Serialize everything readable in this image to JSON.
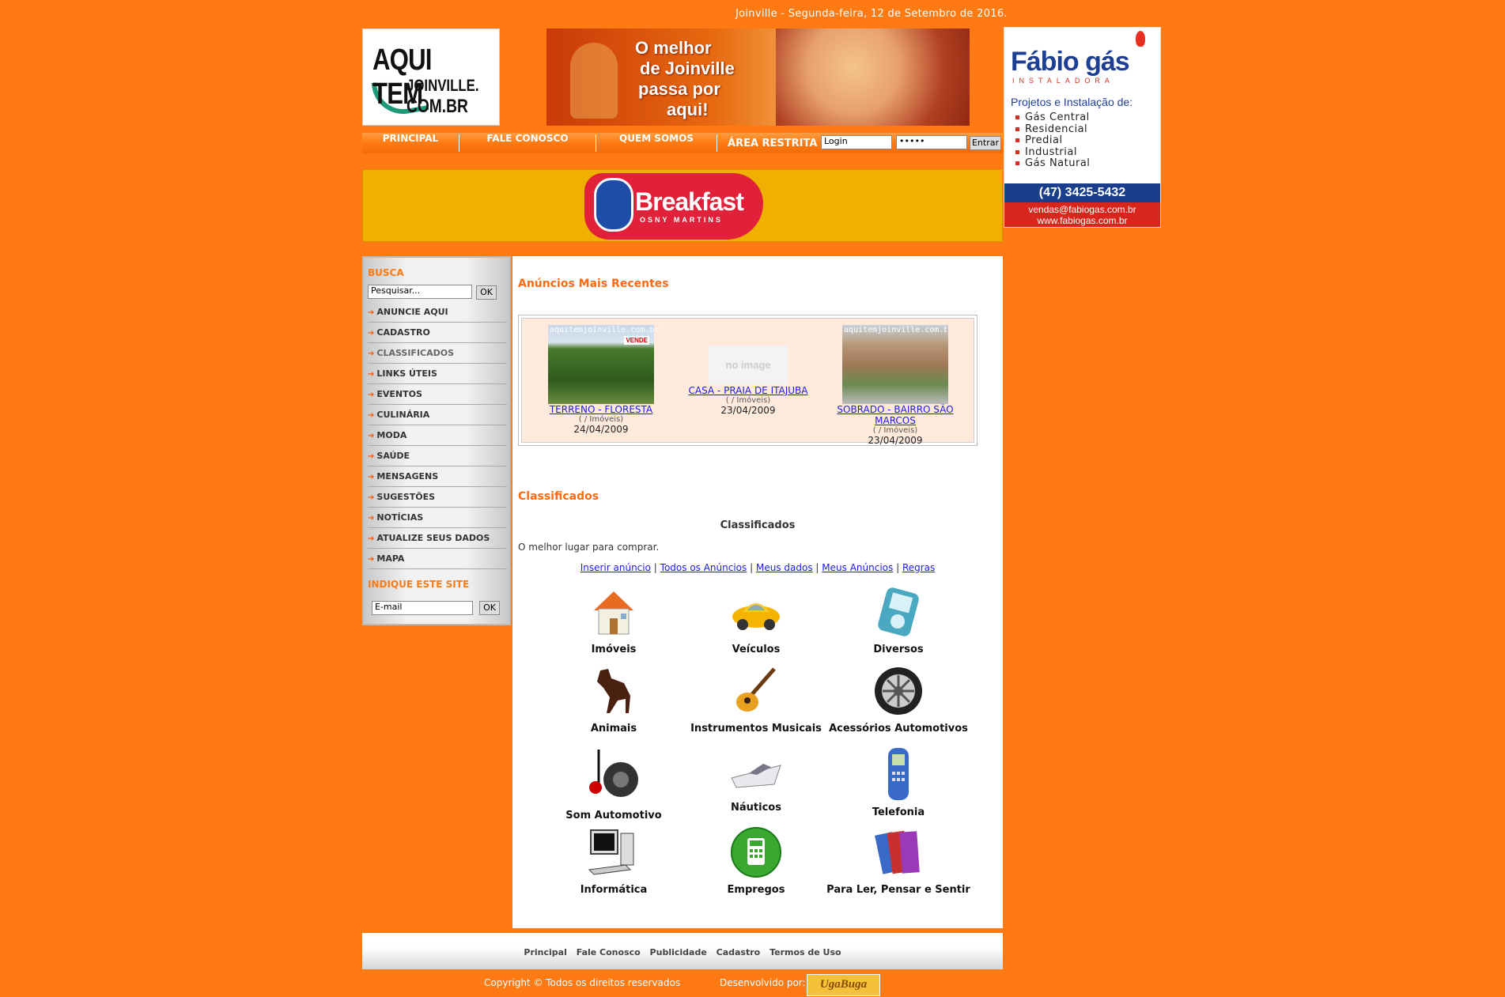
{
  "header": {
    "date_line": "Joinville - Segunda-feira, 12 de Setembro de 2016.",
    "logo": {
      "line1": "AQUI TEM",
      "line2": "JOINVILLE.",
      "line3": "COM.BR"
    },
    "banner": {
      "line1": "O melhor",
      "line2": "de Joinville",
      "line3": "passa por",
      "line4": "aqui!"
    }
  },
  "ad_fabio": {
    "brand": "Fábio gás",
    "subtitle": "INSTALADORA",
    "heading": "Projetos e Instalação de:",
    "items": [
      "Gás Central",
      "Residencial",
      "Predial",
      "Industrial",
      "Gás Natural"
    ],
    "phone": "(47) 3425-5432",
    "email": "vendas@fabiogas.com.br",
    "site": "www.fabiogas.com.br"
  },
  "nav": {
    "items": [
      "PRINCIPAL",
      "FALE CONOSCO",
      "QUEM SOMOS"
    ],
    "restricted_label": "ÁREA RESTRITA",
    "login_value": "Login",
    "password_value": "•••••",
    "submit_label": "Entrar"
  },
  "breakfast": {
    "title": "Breakfast",
    "subtitle": "OSNY MARTINS"
  },
  "sidebar": {
    "search_title": "BUSCA",
    "search_value": "Pesquisar...",
    "ok_label": "OK",
    "items": [
      "ANUNCIE AQUI",
      "CADASTRO",
      "CLASSIFICADOS",
      "LINKS ÚTEIS",
      "EVENTOS",
      "CULINÁRIA",
      "MODA",
      "SAÚDE",
      "MENSAGENS",
      "SUGESTÕES",
      "NOTÍCIAS",
      "ATUALIZE SEUS DADOS",
      "MAPA"
    ],
    "indique_title": "INDIQUE ESTE SITE",
    "email_value": "E-mail",
    "email_ok_label": "OK"
  },
  "main": {
    "recent_title": "Anúncios Mais Recentes",
    "recent": [
      {
        "title": "TERRENO - FLORESTA",
        "category": "( / Imóveis)",
        "date": "24/04/2009",
        "watermark": "aquitemjoinville.com.br",
        "sign": "VENDE"
      },
      {
        "title": "CASA - PRAIA DE ITAJUBA",
        "category": "( / Imóveis)",
        "date": "23/04/2009",
        "placeholder": "no image"
      },
      {
        "title": "SOBRADO - BAIRRO SÃO MARCOS",
        "category": "( / Imóveis)",
        "date": "23/04/2009",
        "watermark": "aquitemjoinville.com.br"
      }
    ],
    "classificados_title": "Classificados",
    "classificados_heading": "Classificados",
    "classificados_desc": "O melhor lugar para comprar.",
    "links": [
      "Inserir anúncio",
      "Todos os Anúncios",
      "Meus dados",
      "Meus Anúncios",
      "Regras"
    ],
    "link_separator": "|",
    "categories": [
      {
        "label": "Imóveis",
        "icon": "house-icon"
      },
      {
        "label": "Veículos",
        "icon": "car-icon"
      },
      {
        "label": "Diversos",
        "icon": "ipod-icon"
      },
      {
        "label": "Animais",
        "icon": "horse-icon"
      },
      {
        "label": "Instrumentos Musicais",
        "icon": "guitar-icon"
      },
      {
        "label": "Acessórios Automotivos",
        "icon": "wheel-icon"
      },
      {
        "label": "Som Automotivo",
        "icon": "speaker-icon"
      },
      {
        "label": "Náuticos",
        "icon": "boat-icon"
      },
      {
        "label": "Telefonia",
        "icon": "phone-icon"
      },
      {
        "label": "Informática",
        "icon": "computer-icon"
      },
      {
        "label": "Empregos",
        "icon": "calculator-icon"
      },
      {
        "label": "Para Ler, Pensar e Sentir",
        "icon": "books-icon"
      }
    ]
  },
  "footer": {
    "links": [
      "Principal",
      "Fale Conosco",
      "Publicidade",
      "Cadastro",
      "Termos de Uso"
    ],
    "copyright": "Copyright © Todos os direitos reservados",
    "developed_by": "Desenvolvido por:",
    "developer_logo": "UgaBuga"
  }
}
